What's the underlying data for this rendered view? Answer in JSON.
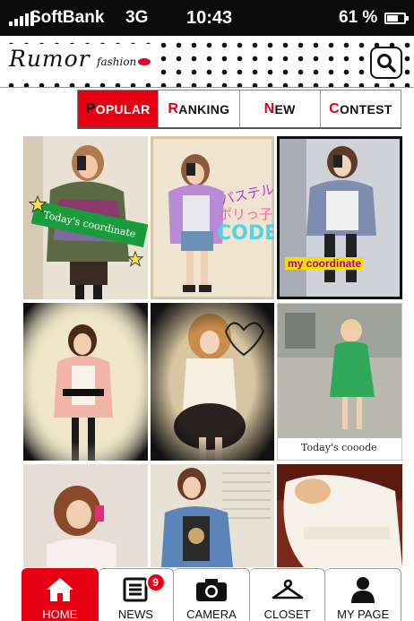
{
  "status_bar": {
    "carrier": "SoftBank",
    "network": "3G",
    "time": "10:43",
    "battery_text": "61 %",
    "battery_level": 0.61
  },
  "header": {
    "logo_text": "Rumor",
    "logo_subtext": "fashion"
  },
  "tabs": [
    {
      "first": "P",
      "rest": "OPULAR",
      "active": true
    },
    {
      "first": "R",
      "rest": "ANKING",
      "active": false
    },
    {
      "first": "N",
      "rest": "EW",
      "active": false
    },
    {
      "first": "C",
      "rest": "ONTEST",
      "active": false
    }
  ],
  "grid": {
    "tile1_caption": "Today's coordinate",
    "tile2_text_line1": "パステル",
    "tile2_text_line2": "ポリっ子",
    "tile2_text_line3": "CODE",
    "tile3_caption": "my coordinate",
    "tile6_caption": "Today's cooode"
  },
  "bottom_nav": [
    {
      "label": "HOME",
      "icon": "home-icon",
      "active": true
    },
    {
      "label": "NEWS",
      "icon": "news-icon",
      "badge": "9"
    },
    {
      "label": "CAMERA",
      "icon": "camera-icon"
    },
    {
      "label": "CLOSET",
      "icon": "hanger-icon"
    },
    {
      "label": "MY PAGE",
      "icon": "person-icon"
    }
  ],
  "colors": {
    "accent": "#e60012",
    "status_bar": "#0b0b0b"
  }
}
